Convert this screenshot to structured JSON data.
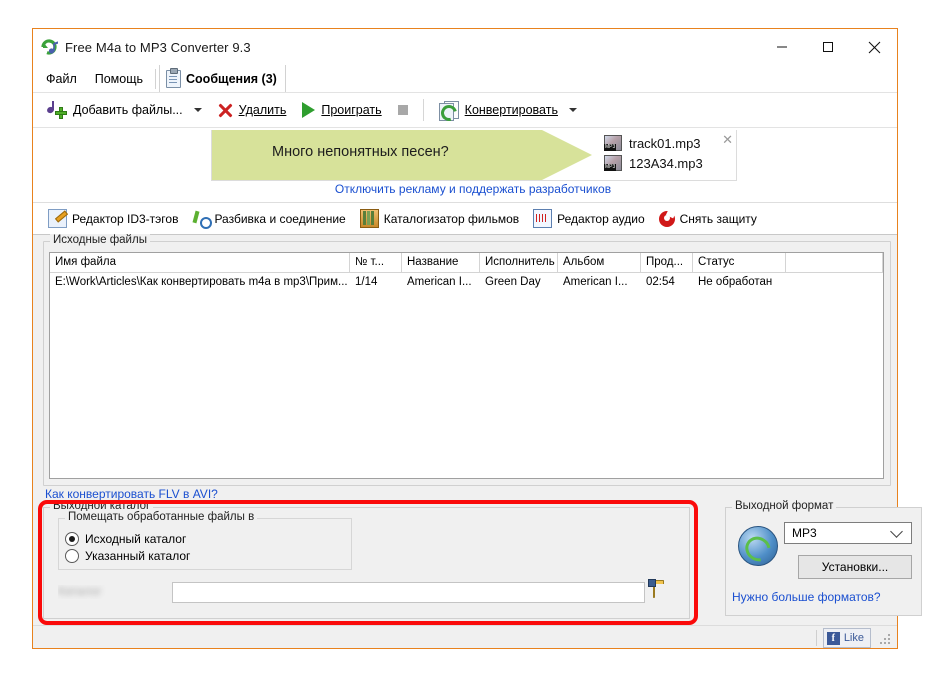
{
  "window": {
    "title": "Free M4a to MP3 Converter 9.3",
    "icon": "app-converter-icon",
    "controls": {
      "minimize": "—",
      "maximize": "☐",
      "close": "✕"
    }
  },
  "menu": {
    "items": [
      {
        "label": "Файл"
      },
      {
        "label": "Помощь"
      }
    ],
    "messages_tab": {
      "label": "Сообщения (3)",
      "icon": "clipboard-icon"
    }
  },
  "toolbar": {
    "add_files": {
      "label": "Добавить файлы...",
      "icon": "add-music-note-icon"
    },
    "delete": {
      "label": "Удалить",
      "icon": "red-cross-icon"
    },
    "play": {
      "label": "Проиграть",
      "icon": "green-play-icon"
    },
    "stop": {
      "icon": "stop-square-icon"
    },
    "convert": {
      "label": "Конвертировать",
      "icon": "convert-pages-icon"
    }
  },
  "ad": {
    "headline": "Много непонятных песен?",
    "files": [
      {
        "name": "track01.mp3",
        "icon": "mp3-file-icon"
      },
      {
        "name": "123A34.mp3",
        "icon": "mp3-file-icon"
      }
    ],
    "close": "✕",
    "disable_link": "Отключить рекламу и поддержать разработчиков",
    "banner_color": "#d7e29a"
  },
  "tools_tabs": [
    {
      "label": "Редактор ID3-тэгов",
      "icon": "id3-editor-icon"
    },
    {
      "label": "Разбивка и соединение",
      "icon": "scissors-icon"
    },
    {
      "label": "Каталогизатор фильмов",
      "icon": "film-catalog-icon"
    },
    {
      "label": "Редактор аудио",
      "icon": "waveform-icon"
    },
    {
      "label": "Снять защиту",
      "icon": "unlock-disc-icon"
    }
  ],
  "source_files": {
    "legend": "Исходные файлы",
    "columns": [
      "Имя файла",
      "№ т...",
      "Название",
      "Исполнитель",
      "Альбом",
      "Прод...",
      "Статус",
      ""
    ],
    "rows": [
      {
        "filename": "E:\\Work\\Articles\\Как конвертировать m4a в mp3\\Прим...",
        "track": "1/14",
        "title": "American I...",
        "artist": "Green Day",
        "album": "American I...",
        "duration": "02:54",
        "status": "Не обработан",
        "extra": ""
      }
    ]
  },
  "flv_link": "Как конвертировать FLV в AVI?",
  "output_dir": {
    "legend": "Выходной каталог",
    "place_legend": "Помещать обработанные файлы в",
    "options": [
      {
        "label": "Исходный каталог",
        "selected": true
      },
      {
        "label": "Указанный каталог",
        "selected": false
      }
    ],
    "path_label": "Каталог",
    "path_value": "",
    "browse_icon": "folder-browse-icon",
    "highlight_color": "#fa0a0a"
  },
  "output_format": {
    "legend": "Выходной формат",
    "icon": "globe-convert-icon",
    "selected": "MP3",
    "settings_button": "Установки...",
    "more_link": "Нужно больше форматов?"
  },
  "status_bar": {
    "facebook_like": "Like",
    "facebook_glyph": "f"
  }
}
